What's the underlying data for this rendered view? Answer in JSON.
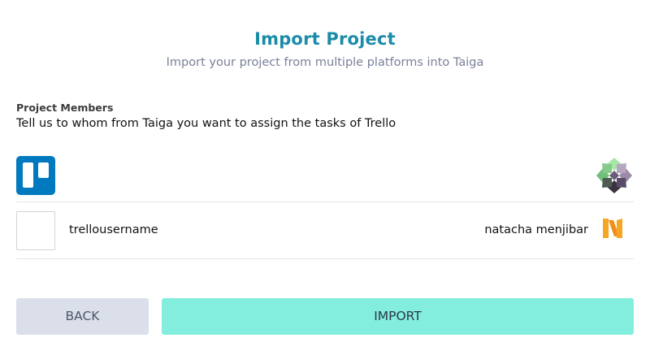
{
  "header": {
    "title": "Import Project",
    "subtitle": "Import your project from multiple platforms into Taiga"
  },
  "members_section": {
    "label": "Project Members",
    "description": "Tell us to whom from Taiga you want to assign the tasks of Trello"
  },
  "platforms": {
    "source_icon": "trello-logo-icon",
    "target_icon": "taiga-logo-icon"
  },
  "mapping": {
    "source_user": "trellousername",
    "source_avatar_icon": "empty-avatar",
    "target_user": "natacha menjibar",
    "target_avatar_icon": "user-avatar-icon"
  },
  "actions": {
    "back_label": "BACK",
    "import_label": "IMPORT"
  },
  "colors": {
    "title": "#1a8ca8",
    "trello_blue": "#0079bf",
    "back_button": "#dadfe9",
    "import_button": "#83eedd"
  }
}
